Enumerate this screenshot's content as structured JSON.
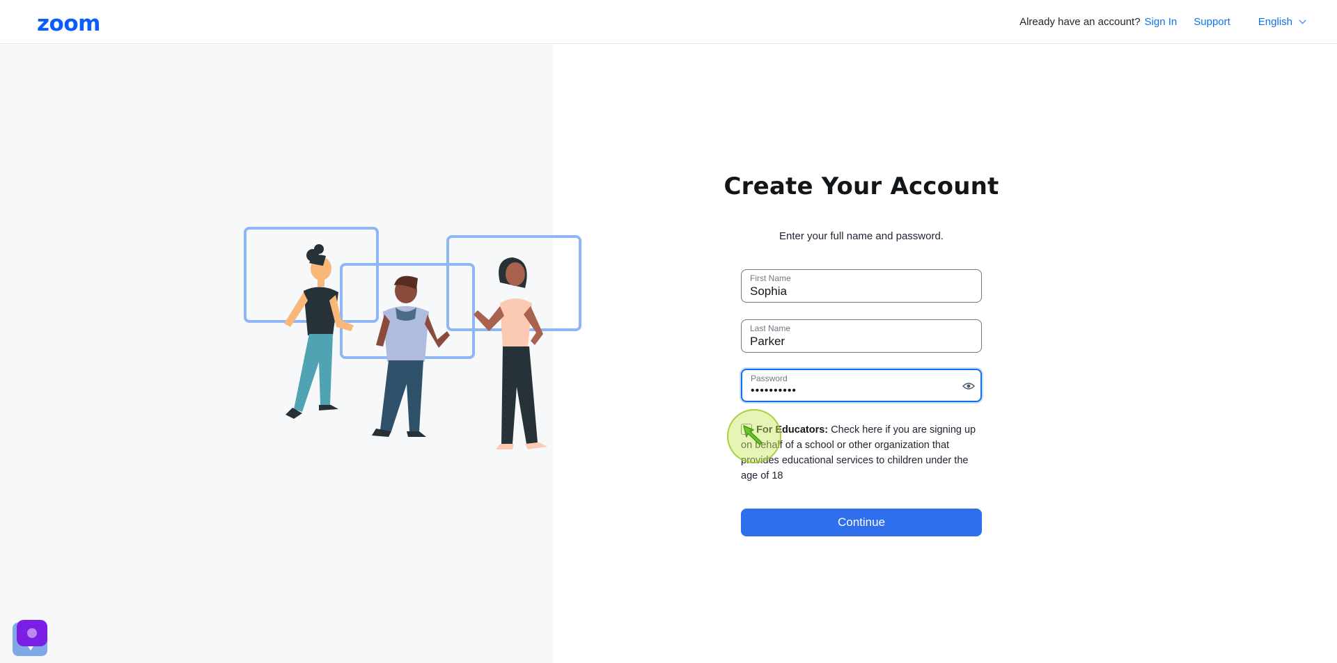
{
  "header": {
    "logo": "zoom",
    "already_text": "Already have an account?",
    "signin_label": "Sign In",
    "support_label": "Support",
    "language_label": "English"
  },
  "main": {
    "title": "Create Your Account",
    "subtitle": "Enter your full name and password.",
    "fields": {
      "first_name": {
        "label": "First Name",
        "value": "Sophia"
      },
      "last_name": {
        "label": "Last Name",
        "value": "Parker"
      },
      "password": {
        "label": "Password",
        "value": "••••••••••"
      }
    },
    "educators": {
      "bold": "For Educators:",
      "text": " Check here if you are signing up on behalf of a school or other organization that provides educational services to children under the age of 18",
      "checked": false
    },
    "continue_label": "Continue"
  },
  "colors": {
    "accent": "#0e72ed",
    "button": "#2f6fed",
    "logo": "#0b5cff",
    "left_panel_bg": "#f7f8fa"
  }
}
